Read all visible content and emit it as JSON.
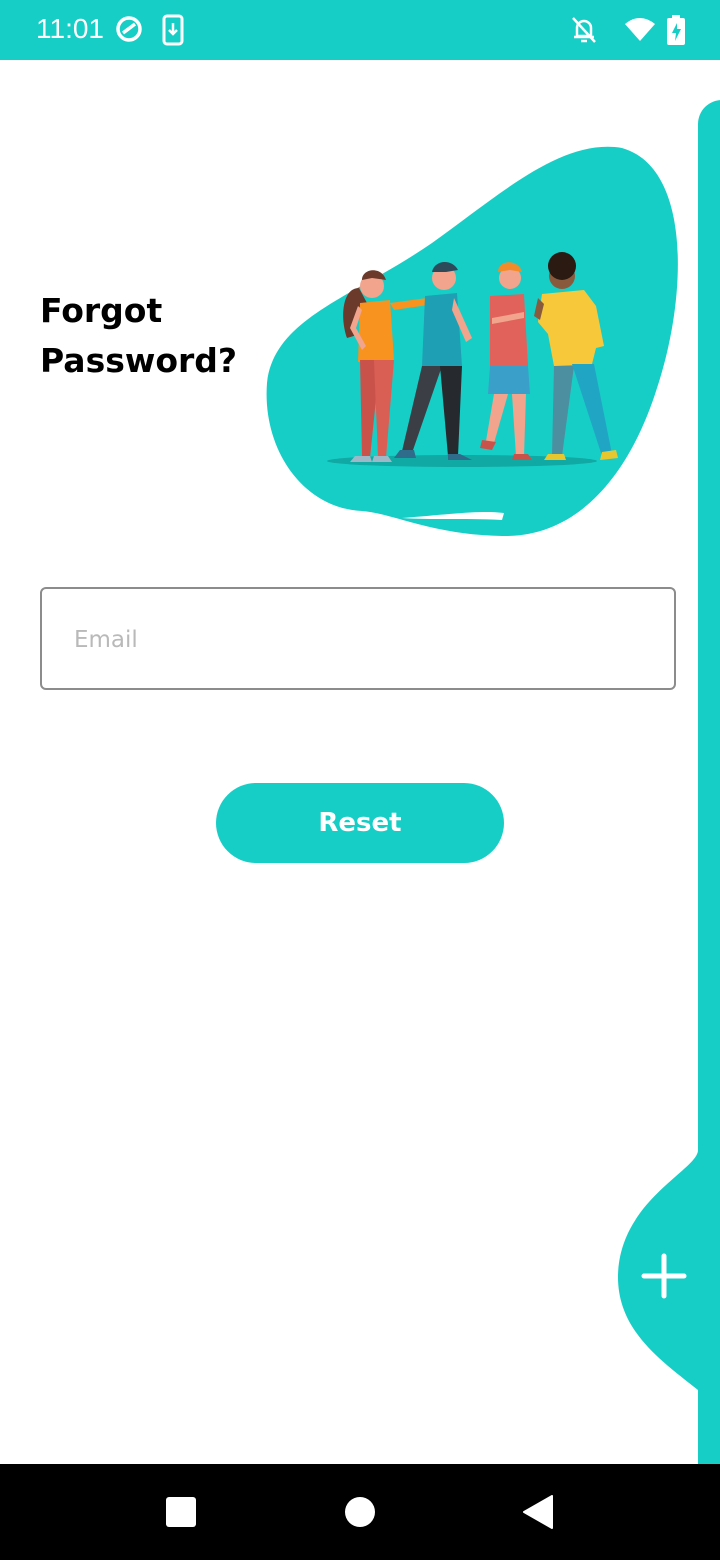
{
  "status_bar": {
    "time": "11:01",
    "icons": [
      "do-not-disturb-icon",
      "download-icon",
      "notifications-off-icon",
      "wifi-icon",
      "battery-charging-icon"
    ]
  },
  "page": {
    "title_line1": "Forgot",
    "title_line2": "Password?"
  },
  "form": {
    "email_placeholder": "Email",
    "email_value": "",
    "reset_label": "Reset"
  },
  "navigation": {
    "buttons": [
      "recent-apps-button",
      "home-button",
      "back-button"
    ]
  },
  "colors": {
    "accent": "#17cec7",
    "background": "#ffffff",
    "nav_bar": "#000000"
  }
}
